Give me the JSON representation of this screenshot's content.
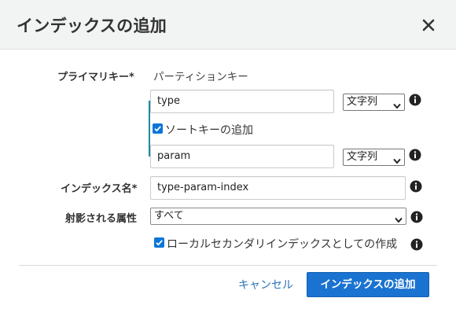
{
  "dialog": {
    "title": "インデックスの追加",
    "close_icon": "close-icon"
  },
  "form": {
    "primary_key": {
      "label": "プライマリキー*",
      "value_text": "パーティションキー",
      "partition_key": {
        "value": "type",
        "type": "文字列"
      },
      "sort_key_checkbox": {
        "label": "ソートキーの追加",
        "checked": true
      },
      "sort_key": {
        "value": "param",
        "type": "文字列"
      }
    },
    "index_name": {
      "label": "インデックス名*",
      "value": "type-param-index"
    },
    "projected_attributes": {
      "label": "射影される属性",
      "selected": "すべて"
    },
    "lsi_checkbox": {
      "label": "ローカルセカンダリインデックスとしての作成",
      "checked": true
    }
  },
  "footer": {
    "cancel_label": "キャンセル",
    "submit_label": "インデックスの追加"
  },
  "colors": {
    "header_bg": "#f2f3f3",
    "bracket": "#1b8a9e",
    "checkbox": "#0b76d8",
    "primary_button": "#1a73d1",
    "link": "#2a73b8"
  },
  "icons": [
    "close-icon",
    "info-icon",
    "chevron-down-icon",
    "checkmark-icon"
  ]
}
